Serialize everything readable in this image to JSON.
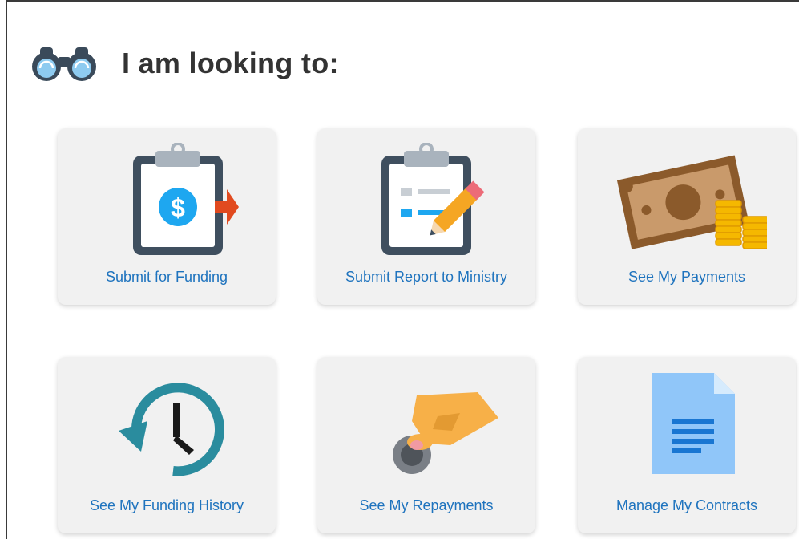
{
  "header": {
    "title": "I am looking to:",
    "icon": "binoculars-icon"
  },
  "tiles": [
    {
      "label": "Submit for Funding",
      "icon": "clipboard-dollar-arrow-icon"
    },
    {
      "label": "Submit Report to Ministry",
      "icon": "clipboard-pencil-icon"
    },
    {
      "label": "See My Payments",
      "icon": "money-coins-icon"
    },
    {
      "label": "See My Funding History",
      "icon": "history-clock-icon"
    },
    {
      "label": "See My Repayments",
      "icon": "hand-coin-icon"
    },
    {
      "label": "Manage My Contracts",
      "icon": "document-icon"
    }
  ],
  "colors": {
    "link": "#1e73be",
    "tile_bg": "#f1f1f1",
    "title": "#333333",
    "dollar_blue": "#1ea7f0",
    "arrow_red": "#e14a1f",
    "clock_teal": "#2a8c9e",
    "hand_orange": "#f7b048",
    "doc_blue": "#90c6f9"
  }
}
